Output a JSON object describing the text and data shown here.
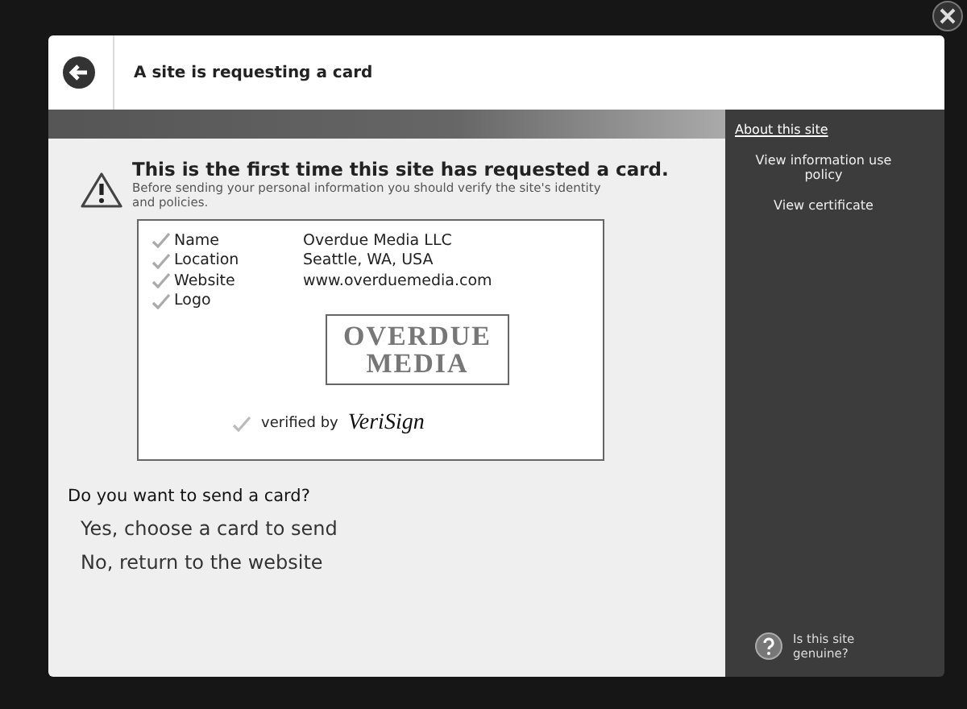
{
  "header": {
    "title": "A site is requesting a card"
  },
  "warning": {
    "heading": "This is the first time this site has requested a card.",
    "text": "Before sending your personal information you should verify the site's identity and policies."
  },
  "card": {
    "fields": [
      {
        "label": "Name",
        "value": "Overdue Media LLC"
      },
      {
        "label": "Location",
        "value": "Seattle, WA, USA"
      },
      {
        "label": "Website",
        "value": "www.overduemedia.com"
      },
      {
        "label": "Logo"
      }
    ],
    "logo": [
      "OVERDUE",
      "MEDIA"
    ],
    "verified_by": "verified by",
    "verifier": "VeriSign"
  },
  "question": "Do you want to send a card?",
  "options": [
    "Yes, choose a card to send",
    "No, return to the website"
  ],
  "sidebar": {
    "heading": "About this site",
    "links": [
      "View information use policy",
      "View certificate"
    ],
    "help": "Is this site genuine?"
  }
}
